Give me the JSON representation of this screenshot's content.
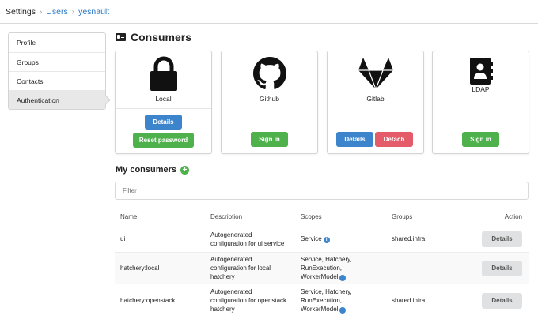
{
  "breadcrumb": {
    "root": "Settings",
    "users": "Users",
    "current": "yesnault"
  },
  "sidebar": {
    "items": [
      {
        "label": "Profile"
      },
      {
        "label": "Groups"
      },
      {
        "label": "Contacts"
      },
      {
        "label": "Authentication"
      }
    ]
  },
  "page": {
    "title": "Consumers"
  },
  "cards": {
    "local": {
      "name": "Local",
      "details": "Details",
      "reset": "Reset password"
    },
    "github": {
      "name": "Github",
      "signin": "Sign in"
    },
    "gitlab": {
      "name": "Gitlab",
      "details": "Details",
      "detach": "Detach"
    },
    "ldap": {
      "name": "LDAP",
      "signin": "Sign in"
    }
  },
  "my_consumers": {
    "title": "My consumers",
    "filter_placeholder": "Filter"
  },
  "table": {
    "headers": {
      "name": "Name",
      "description": "Description",
      "scopes": "Scopes",
      "groups": "Groups",
      "action": "Action"
    },
    "rows": [
      {
        "name": "ui",
        "desc1": "Autogenerated",
        "desc2": "configuration for ui service",
        "desc3": "",
        "scope1": "Service",
        "scope2": "",
        "scope3": "",
        "scope4": "",
        "groups": "shared.infra",
        "action": "Details"
      },
      {
        "name": "hatchery:local",
        "desc1": "Autogenerated",
        "desc2": "configuration for local",
        "desc3": "hatchery",
        "scope1": "Service, Hatchery,",
        "scope2": "RunExecution,",
        "scope3": "WorkerModel",
        "scope4": "",
        "groups": "",
        "action": "Details"
      },
      {
        "name": "hatchery:openstack",
        "desc1": "Autogenerated",
        "desc2": "configuration for openstack",
        "desc3": "hatchery",
        "scope1": "Service, Hatchery,",
        "scope2": "RunExecution,",
        "scope3": "WorkerModel",
        "scope4": "",
        "groups": "shared.infra",
        "action": "Details"
      }
    ]
  },
  "colors": {
    "link": "#2b78c5",
    "primary": "#3c84cc",
    "success": "#4eb14b",
    "danger": "#e45c6a"
  }
}
